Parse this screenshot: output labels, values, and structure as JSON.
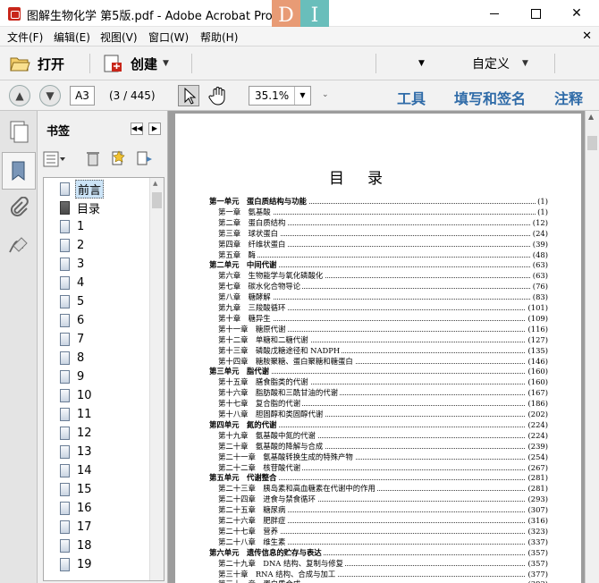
{
  "window": {
    "title": "图解生物化学 第5版.pdf - Adobe Acrobat Pro",
    "overlay_a": "D",
    "overlay_b": "I"
  },
  "menu": [
    "文件(F)",
    "编辑(E)",
    "视图(V)",
    "窗口(W)",
    "帮助(H)"
  ],
  "toolbar": {
    "open_label": "打开",
    "create_label": "创建",
    "customize_label": "自定义"
  },
  "nav": {
    "page_value": "A3",
    "page_count": "(3 / 445)",
    "zoom": "35.1%",
    "tools_label": "工具",
    "sign_label": "填写和签名",
    "comment_label": "注释"
  },
  "bookmarks": {
    "title": "书签",
    "items": [
      {
        "label": "前言",
        "selected": true,
        "icon": "bookmark-icon"
      },
      {
        "label": "目录",
        "icon": "bookmark-icon-dark"
      },
      {
        "label": "1"
      },
      {
        "label": "2"
      },
      {
        "label": "3"
      },
      {
        "label": "4"
      },
      {
        "label": "5"
      },
      {
        "label": "6"
      },
      {
        "label": "7"
      },
      {
        "label": "8"
      },
      {
        "label": "9"
      },
      {
        "label": "10"
      },
      {
        "label": "11"
      },
      {
        "label": "12"
      },
      {
        "label": "13"
      },
      {
        "label": "14"
      },
      {
        "label": "15"
      },
      {
        "label": "16"
      },
      {
        "label": "17"
      },
      {
        "label": "18"
      },
      {
        "label": "19"
      }
    ]
  },
  "document": {
    "heading": "目录",
    "toc": [
      {
        "text": "第一单元　蛋白质结构与功能",
        "page": "(1)",
        "unit": true
      },
      {
        "text": "第一章　氨基酸",
        "page": "(1)"
      },
      {
        "text": "第二章　蛋白质结构",
        "page": "(12)"
      },
      {
        "text": "第三章　球状蛋白",
        "page": "(24)"
      },
      {
        "text": "第四章　纤维状蛋白",
        "page": "(39)"
      },
      {
        "text": "第五章　酶",
        "page": "(48)"
      },
      {
        "text": "第二单元　中间代谢",
        "page": "(63)",
        "unit": true
      },
      {
        "text": "第六章　生物能学与氧化磷酸化",
        "page": "(63)"
      },
      {
        "text": "第七章　碳水化合物导论",
        "page": "(76)"
      },
      {
        "text": "第八章　糖酵解",
        "page": "(83)"
      },
      {
        "text": "第九章　三羧酸循环",
        "page": "(101)"
      },
      {
        "text": "第十章　糖异生",
        "page": "(109)"
      },
      {
        "text": "第十一章　糖原代谢",
        "page": "(116)"
      },
      {
        "text": "第十二章　单糖和二糖代谢",
        "page": "(127)"
      },
      {
        "text": "第十三章　磷酸戊糖途径和 NADPH",
        "page": "(135)"
      },
      {
        "text": "第十四章　糖胺聚糖、蛋白聚糖和糖蛋白",
        "page": "(146)"
      },
      {
        "text": "第三单元　脂代谢",
        "page": "(160)",
        "unit": true
      },
      {
        "text": "第十五章　膳食脂类的代谢",
        "page": "(160)"
      },
      {
        "text": "第十六章　脂肪酸和三酰甘油的代谢",
        "page": "(167)"
      },
      {
        "text": "第十七章　复合脂的代谢",
        "page": "(186)"
      },
      {
        "text": "第十八章　胆固醇和类固醇代谢",
        "page": "(202)"
      },
      {
        "text": "第四单元　氮的代谢",
        "page": "(224)",
        "unit": true
      },
      {
        "text": "第十九章　氨基酸中氮的代谢",
        "page": "(224)"
      },
      {
        "text": "第二十章　氨基酸的降解与合成",
        "page": "(239)"
      },
      {
        "text": "第二十一章　氨基酸转换生成的特殊产物",
        "page": "(254)"
      },
      {
        "text": "第二十二章　核苷酸代谢",
        "page": "(267)"
      },
      {
        "text": "第五单元　代谢整合",
        "page": "(281)",
        "unit": true
      },
      {
        "text": "第二十三章　胰岛素和高血糖素在代谢中的作用",
        "page": "(281)"
      },
      {
        "text": "第二十四章　进食与禁食循环",
        "page": "(293)"
      },
      {
        "text": "第二十五章　糖尿病",
        "page": "(307)"
      },
      {
        "text": "第二十六章　肥胖症",
        "page": "(316)"
      },
      {
        "text": "第二十七章　营养",
        "page": "(323)"
      },
      {
        "text": "第二十八章　维生素",
        "page": "(337)"
      },
      {
        "text": "第六单元　遗传信息的贮存与表达",
        "page": "(357)",
        "unit": true
      },
      {
        "text": "第二十九章　DNA 结构、复制与修复",
        "page": "(357)"
      },
      {
        "text": "第三十章　RNA 结构、合成与加工",
        "page": "(377)"
      },
      {
        "text": "第三十一章　蛋白质合成",
        "page": "(393)"
      }
    ]
  }
}
